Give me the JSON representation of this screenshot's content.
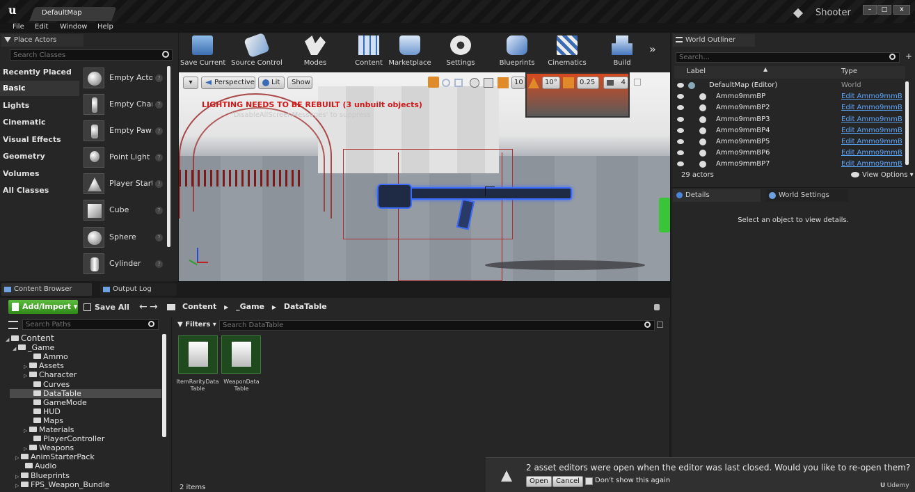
{
  "title_bar": {
    "tab": "DefaultMap",
    "project": "Shooter"
  },
  "menu": [
    "File",
    "Edit",
    "Window",
    "Help"
  ],
  "place_actors": {
    "tab": "Place Actors",
    "search_placeholder": "Search Classes",
    "categories": [
      "Recently Placed",
      "Basic",
      "Lights",
      "Cinematic",
      "Visual Effects",
      "Geometry",
      "Volumes",
      "All Classes"
    ],
    "items": [
      "Empty Actor",
      "Empty Character",
      "Empty Pawn",
      "Point Light",
      "Player Start",
      "Cube",
      "Sphere",
      "Cylinder"
    ]
  },
  "toolbar": {
    "buttons": [
      "Save Current",
      "Source Control",
      "Modes",
      "Content",
      "Marketplace",
      "Settings",
      "Blueprints",
      "Cinematics",
      "Build"
    ]
  },
  "viewport": {
    "perspective": "Perspective",
    "lit": "Lit",
    "show": "Show",
    "grid_snap": "10",
    "rot_snap": "10°",
    "scale_snap": "0.25",
    "cam_speed": "4",
    "warning": "LIGHTING NEEDS TO BE REBUILT (3 unbuilt objects)",
    "warning_sub": "'DisableAllScreenMessages' to suppress"
  },
  "outliner": {
    "tab": "World Outliner",
    "search_placeholder": "Search...",
    "col_label": "Label",
    "col_type": "Type",
    "rows": [
      {
        "label": "DefaultMap (Editor)",
        "type": "World"
      },
      {
        "label": "Ammo9mmBP",
        "type": "Edit Ammo9mmB"
      },
      {
        "label": "Ammo9mmBP2",
        "type": "Edit Ammo9mmB"
      },
      {
        "label": "Ammo9mmBP3",
        "type": "Edit Ammo9mmB"
      },
      {
        "label": "Ammo9mmBP4",
        "type": "Edit Ammo9mmB"
      },
      {
        "label": "Ammo9mmBP5",
        "type": "Edit Ammo9mmB"
      },
      {
        "label": "Ammo9mmBP6",
        "type": "Edit Ammo9mmB"
      },
      {
        "label": "Ammo9mmBP7",
        "type": "Edit Ammo9mmB"
      }
    ],
    "count": "29 actors",
    "view_options": "View Options"
  },
  "details": {
    "tab": "Details",
    "tab2": "World Settings",
    "empty": "Select an object to view details."
  },
  "content_browser": {
    "tab": "Content Browser",
    "tab2": "Output Log",
    "add_import": "Add/Import",
    "save_all": "Save All",
    "breadcrumb": [
      "Content",
      "_Game",
      "DataTable"
    ],
    "search_paths": "Search Paths",
    "filters": "Filters",
    "search_assets": "Search DataTable",
    "tree": [
      {
        "label": "Content",
        "arrow": "◢"
      },
      {
        "label": "_Game",
        "arrow": "◢"
      },
      {
        "label": "Ammo",
        "arrow": ""
      },
      {
        "label": "Assets",
        "arrow": "▷"
      },
      {
        "label": "Character",
        "arrow": "▷"
      },
      {
        "label": "Curves",
        "arrow": ""
      },
      {
        "label": "DataTable",
        "arrow": ""
      },
      {
        "label": "GameMode",
        "arrow": ""
      },
      {
        "label": "HUD",
        "arrow": ""
      },
      {
        "label": "Maps",
        "arrow": ""
      },
      {
        "label": "Materials",
        "arrow": "▷"
      },
      {
        "label": "PlayerController",
        "arrow": ""
      },
      {
        "label": "Weapons",
        "arrow": "▷"
      },
      {
        "label": "AnimStarterPack",
        "arrow": "▷"
      },
      {
        "label": "Audio",
        "arrow": ""
      },
      {
        "label": "Blueprints",
        "arrow": "▷"
      },
      {
        "label": "FPS_Weapon_Bundle",
        "arrow": "▷"
      }
    ],
    "assets": [
      {
        "line1": "ItemRarityData",
        "line2": "Table"
      },
      {
        "line1": "WeaponData",
        "line2": "Table"
      }
    ],
    "count": "2 items"
  },
  "notification": {
    "message": "2 asset editors were open when the editor was last closed. Would you like to re-open them?",
    "open": "Open",
    "cancel": "Cancel",
    "dont_show": "Don't show this again"
  },
  "watermark": "Udemy"
}
